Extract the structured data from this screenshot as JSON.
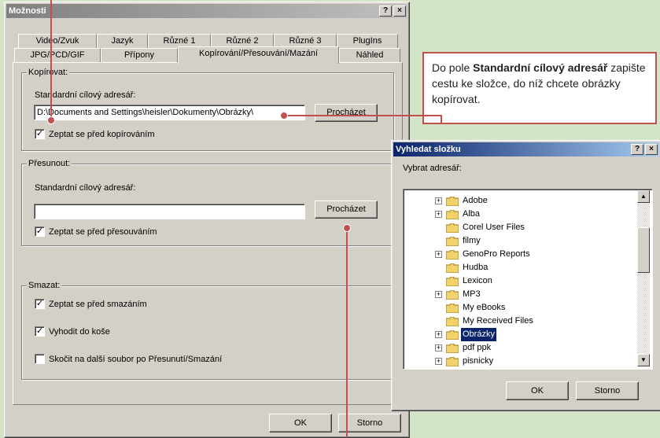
{
  "main_dialog": {
    "title": "Možnosti",
    "title_buttons": {
      "help": "?",
      "close": "×"
    },
    "tabs_row1": [
      "Video/Zvuk",
      "Jazyk",
      "Různé 1",
      "Různé 2",
      "Různé 3",
      "PlugIns"
    ],
    "tabs_row2": [
      "JPG/PCD/GIF",
      "Přípony",
      "Kopírování/Přesouvání/Mazání",
      "Náhled"
    ],
    "copy": {
      "group_label": "Kopírovat:",
      "field_label": "Standardní cílový adresář:",
      "field_value": "D:\\Documents and Settings\\heisler\\Dokumenty\\Obrázky\\",
      "browse_label": "Procházet",
      "checkbox_label": "Zeptat se před kopírováním",
      "checkbox_checked": true
    },
    "move": {
      "group_label": "Přesunout:",
      "field_label": "Standardní cílový adresář:",
      "field_value": "",
      "browse_label": "Procházet",
      "checkbox_label": "Zeptat se před přesouváním",
      "checkbox_checked": true
    },
    "delete": {
      "group_label": "Smazat:",
      "checkboxes": [
        {
          "label": "Zeptat se před smazáním",
          "checked": true
        },
        {
          "label": "Vyhodit do koše",
          "checked": true
        },
        {
          "label": "Skočit na další soubor po Přesunutí/Smazání",
          "checked": false
        }
      ]
    },
    "ok_label": "OK",
    "cancel_label": "Storno"
  },
  "callout": {
    "text_prefix": "Do pole ",
    "text_bold": "Standardní cílový adresář",
    "text_suffix": " zapište cestu ke složce, do níž chce­te obrázky kopírovat."
  },
  "folder_dialog": {
    "title": "Vyhledat složku",
    "title_buttons": {
      "help": "?",
      "close": "×"
    },
    "prompt": "Vybrat adresář:",
    "items": [
      {
        "label": "Adobe",
        "expandable": true
      },
      {
        "label": "Alba",
        "expandable": true
      },
      {
        "label": "Corel User Files",
        "expandable": false
      },
      {
        "label": "filmy",
        "expandable": false
      },
      {
        "label": "GenoPro Reports",
        "expandable": true
      },
      {
        "label": "Hudba",
        "expandable": false
      },
      {
        "label": "Lexicon",
        "expandable": false
      },
      {
        "label": "MP3",
        "expandable": true
      },
      {
        "label": "My eBooks",
        "expandable": false
      },
      {
        "label": "My Received Files",
        "expandable": false
      },
      {
        "label": "Obrázky",
        "expandable": true,
        "selected": true
      },
      {
        "label": "pdf ppk",
        "expandable": true
      },
      {
        "label": "pisnicky",
        "expandable": true
      }
    ],
    "ok_label": "OK",
    "cancel_label": "Storno"
  },
  "colors": {
    "accent": "#c0504d",
    "selection": "#0a246a",
    "background": "#d3e4c7"
  }
}
